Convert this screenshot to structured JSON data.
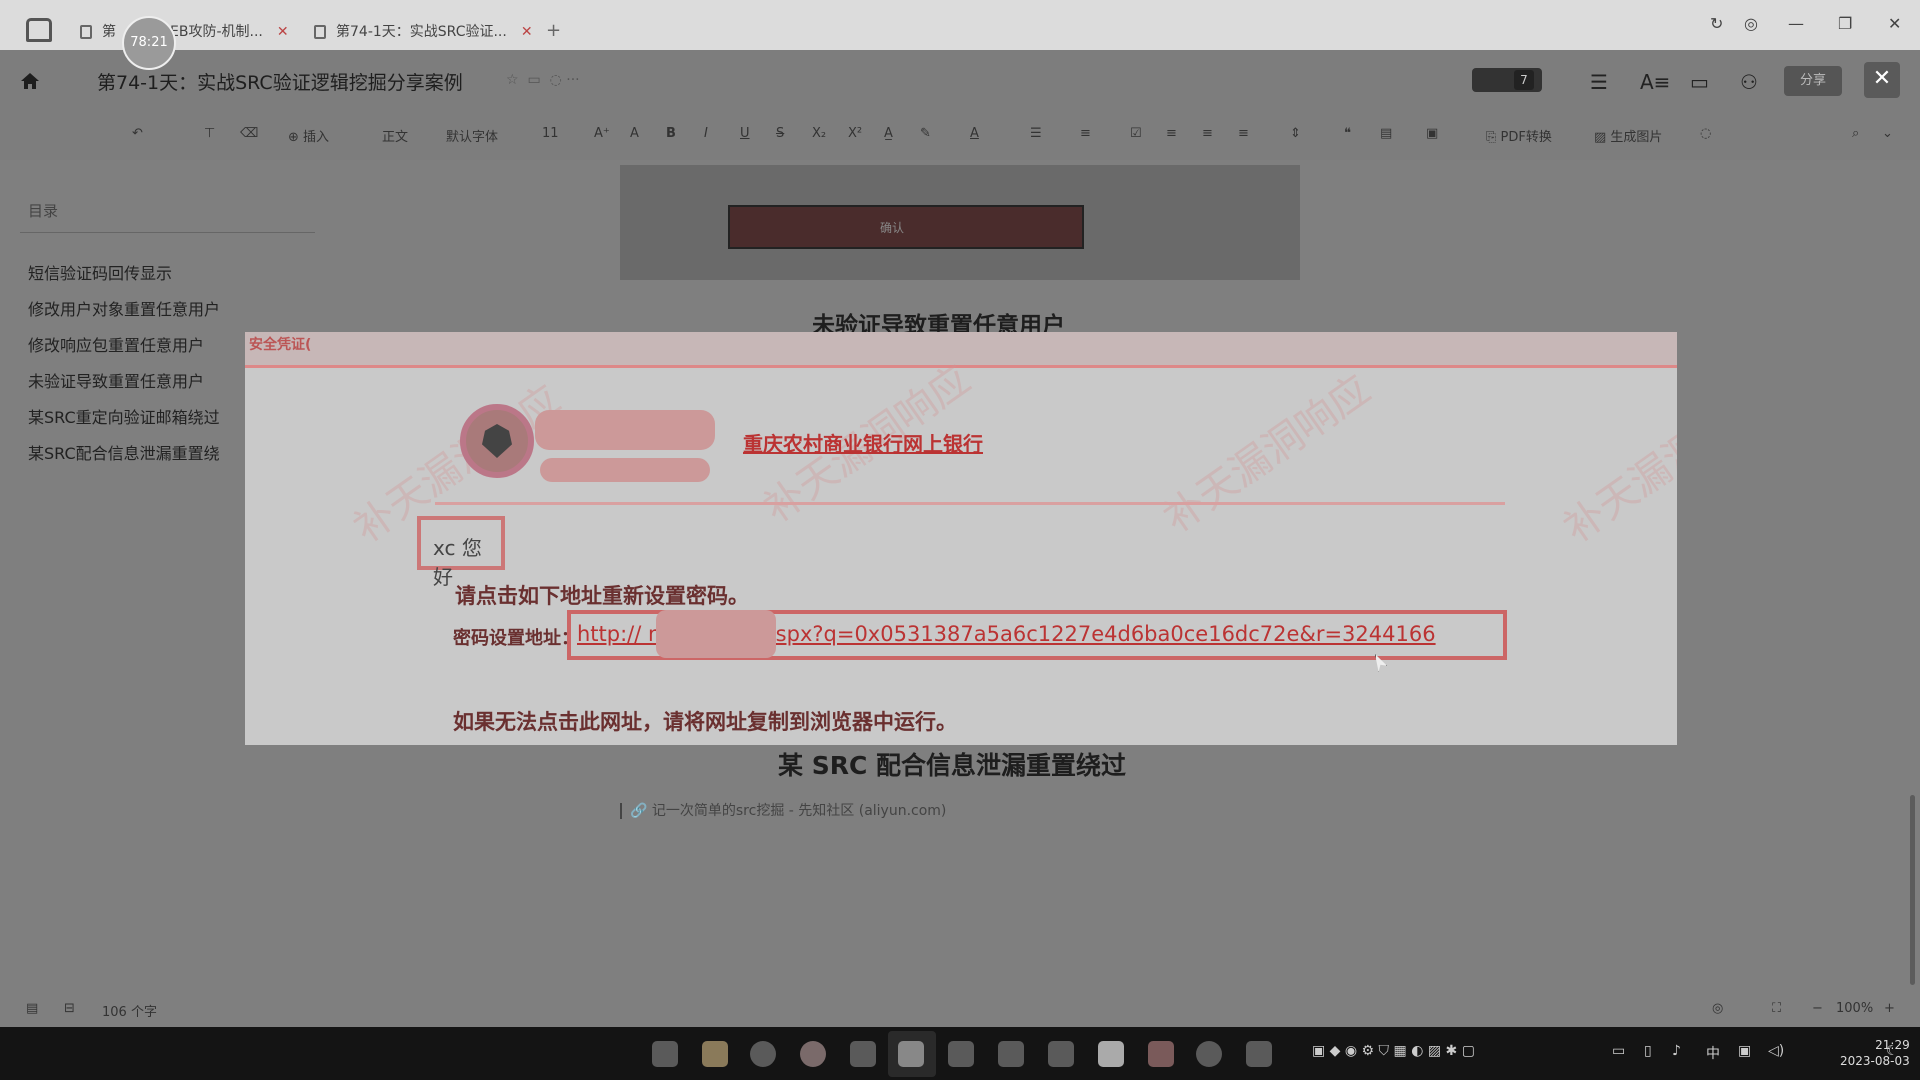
{
  "timer": "78:21",
  "tabs": [
    {
      "label": "第",
      "label_tail": "EB攻防-机制..."
    },
    {
      "label": "第74-1天：实战SRC验证..."
    }
  ],
  "doc_title": "第74-1天：实战SRC验证逻辑挖掘分享案例",
  "header": {
    "avatar_count": "7",
    "share_label": "分享",
    "overlay_close": "✕"
  },
  "toolbar": {
    "insert": "插入",
    "style": "正文",
    "font": "默认字体",
    "font_size": "11",
    "pdf": "PDF转换",
    "image": "生成图片"
  },
  "toc": {
    "header": "目录",
    "items": [
      "短信验证码回传显示",
      "修改用户对象重置任意用户",
      "修改响应包重置任意用户",
      "未验证导致重置任意用户",
      "某SRC重定向验证邮箱绕过",
      "某SRC配合信息泄漏重置绕"
    ]
  },
  "document": {
    "heading_behind": "未验证导致重置任意用户",
    "heading_2": "某 SRC 配合信息泄漏重置绕过",
    "link_text": "记一次简单的src挖掘 - 先知社区 (aliyun.com)",
    "top_image_button": "确认"
  },
  "zoom_image": {
    "band_text": "安全凭证(",
    "bank_name": "重庆农村商业银行网上银行",
    "watermark": "补天漏洞响应",
    "user_label": "xc 您好",
    "line1": "请点击如下地址重新设置密码。",
    "reset_label": "密码设置地址：",
    "url": "http://                  m/GetPwd.aspx?q=0x0531387a5a6c1227e4d6ba0ce16dc72e&r=3244166",
    "line3": "如果无法点击此网址，请将网址复制到浏览器中运行。"
  },
  "status": {
    "word_count": "106 个字",
    "zoom": "100%"
  },
  "clock": {
    "time": "21:29",
    "date": "2023-08-03"
  },
  "tray_ime": "中"
}
